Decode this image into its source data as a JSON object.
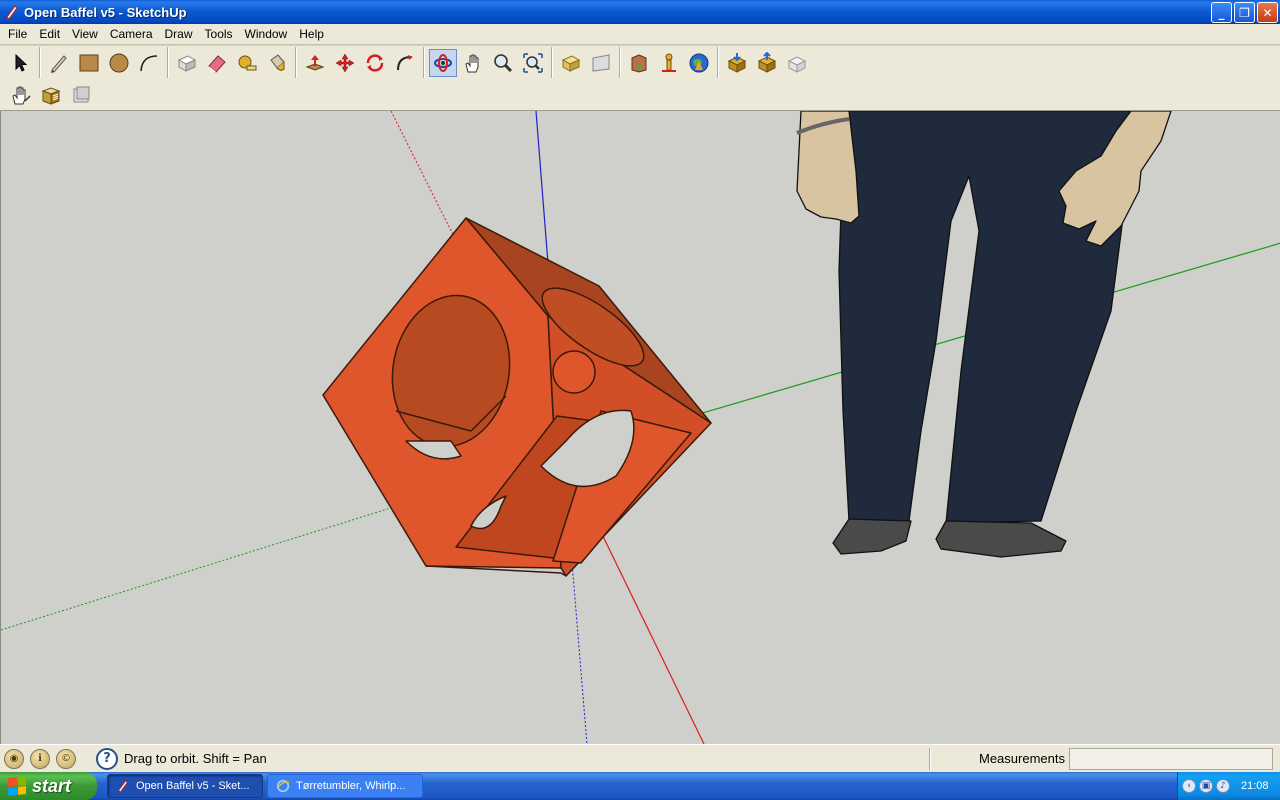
{
  "window": {
    "title": "Open Baffel v5 - SketchUp",
    "controls": [
      "minimize",
      "restore",
      "close"
    ]
  },
  "menu": {
    "items": [
      "File",
      "Edit",
      "View",
      "Camera",
      "Draw",
      "Tools",
      "Window",
      "Help"
    ]
  },
  "toolbar_row1": [
    {
      "group": "principal",
      "tools": [
        "select-icon"
      ]
    },
    {
      "group": "drawing",
      "tools": [
        "pencil-icon",
        "rectangle-icon",
        "circle-icon",
        "arc-icon"
      ]
    },
    {
      "group": "principal2",
      "tools": [
        "make-component-icon",
        "eraser-icon",
        "tape-measure-icon",
        "paint-bucket-icon"
      ]
    },
    {
      "group": "modification",
      "tools": [
        "push-pull-icon",
        "move-icon",
        "rotate-icon",
        "follow-me-icon"
      ]
    },
    {
      "group": "camera",
      "tools": [
        "orbit-icon",
        "pan-icon",
        "zoom-icon",
        "zoom-extents-icon"
      ],
      "active": "orbit-icon"
    },
    {
      "group": "views",
      "tools": [
        "previous-view-icon",
        "next-view-icon"
      ]
    },
    {
      "group": "google",
      "tools": [
        "get-models-icon",
        "add-location-icon",
        "google-earth-icon"
      ]
    },
    {
      "group": "components",
      "tools": [
        "get-models-2-icon",
        "share-model-icon",
        "share-component-icon"
      ]
    }
  ],
  "toolbar_row2": [
    "hand-tool-icon",
    "layers-icon",
    "sections-icon"
  ],
  "viewport": {
    "background": "#cfcfcb",
    "axis_colors": {
      "red": "#d42020",
      "green": "#1a9a1a",
      "blue": "#2020c8"
    },
    "model_color": "#e0562c",
    "figure": "scale-figure"
  },
  "status": {
    "icons": [
      "geo-location-icon",
      "credits-icon",
      "copyright-icon"
    ],
    "message": "Drag to orbit.  Shift = Pan",
    "measurements_label": "Measurements",
    "measurements_value": ""
  },
  "taskbar": {
    "start_label": "start",
    "tasks": [
      {
        "label": "Open Baffel v5 - Sket...",
        "active": true
      },
      {
        "label": "Tørretumbler, Whirlp...",
        "active": false
      }
    ],
    "clock": "21:08"
  }
}
